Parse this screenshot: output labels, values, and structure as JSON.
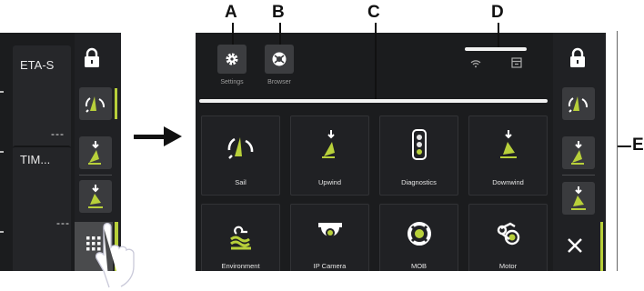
{
  "callouts": {
    "a": "A",
    "b": "B",
    "c": "C",
    "d": "D",
    "e": "E"
  },
  "left_panel": {
    "widget_1_label": "ETA-S",
    "widget_1_value": "---",
    "widget_2_label": "TIM...",
    "widget_2_value": "---"
  },
  "top_bar": {
    "settings_label": "Settings",
    "browser_label": "Browser"
  },
  "apps": [
    {
      "label": "Sail",
      "icon": "sail-icon"
    },
    {
      "label": "Upwind",
      "icon": "upwind-icon"
    },
    {
      "label": "Diagnostics",
      "icon": "diagnostics-icon"
    },
    {
      "label": "Downwind",
      "icon": "downwind-icon"
    },
    {
      "label": "Environment",
      "icon": "environment-icon"
    },
    {
      "label": "IP Camera",
      "icon": "camera-icon"
    },
    {
      "label": "MOB",
      "icon": "lifebuoy-icon"
    },
    {
      "label": "Motor",
      "icon": "motor-icon"
    }
  ],
  "colors": {
    "accent": "#b8d03a",
    "background": "#1b1c1e",
    "tile": "#202124",
    "button": "#3a3b3e"
  },
  "icons": [
    "lock-icon",
    "sail-icon",
    "upwind-icon",
    "downwind-icon",
    "grid-icon",
    "close-icon",
    "wifi-icon",
    "card-icon",
    "gear-icon",
    "browser-icon",
    "hand-icon"
  ]
}
